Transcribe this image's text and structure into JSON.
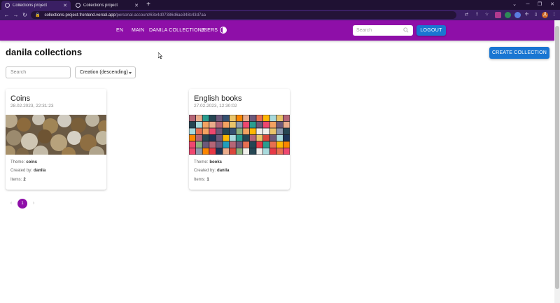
{
  "browser": {
    "tabs": [
      {
        "title": "Collections project",
        "active": true
      },
      {
        "title": "Collections project",
        "active": false
      }
    ],
    "new_tab_symbol": "+",
    "url_host": "collections-project-frontend.vercel.app",
    "url_path": "/personal-account/63e4d07386d6ae348c43d7aa",
    "profile_initial": "Д"
  },
  "appbar": {
    "language": "EN",
    "nav": [
      "MAIN",
      "DANILA COLLECTIONS",
      "USERS"
    ],
    "search_placeholder": "Search",
    "logout_label": "LOGOUT",
    "color": "#8e0fa8"
  },
  "page": {
    "title": "danila collections",
    "create_label": "CREATE COLLECTION",
    "filter_placeholder": "Search",
    "sort_value": "Creation (descending)"
  },
  "cards": [
    {
      "title": "Coins",
      "date": "28.02.2023, 22:31:23",
      "theme_label": "Theme:",
      "theme": "coins",
      "created_label": "Created by:",
      "author": "danila",
      "items_label": "Items:",
      "items": "2",
      "image": "coins-photo"
    },
    {
      "title": "English books",
      "date": "27.02.2023, 12:30:02",
      "theme_label": "Theme:",
      "theme": "books",
      "created_label": "Created by:",
      "author": "danila",
      "items_label": "Items:",
      "items": "1",
      "image": "books-photo"
    }
  ],
  "pagination": {
    "current": "1",
    "prev_symbol": "‹",
    "next_symbol": "›"
  },
  "colors": {
    "accent": "#8e0fa8",
    "primary_button": "#1976d2"
  }
}
